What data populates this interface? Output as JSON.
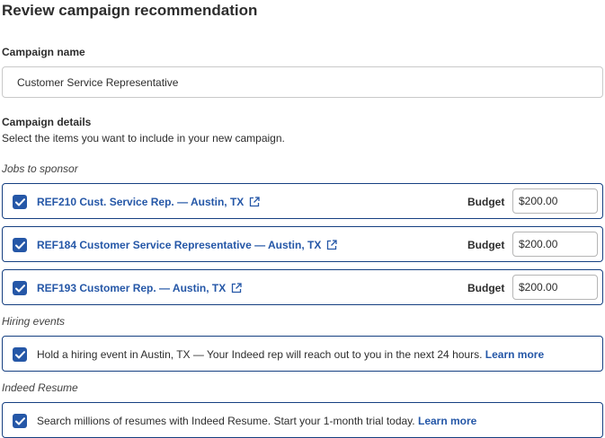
{
  "header": {
    "title": "Review campaign recommendation"
  },
  "campaign_name": {
    "label": "Campaign name",
    "value": "Customer Service Representative"
  },
  "campaign_details": {
    "label": "Campaign details",
    "instructions": "Select the items you want to include in your new campaign."
  },
  "jobs": {
    "group_label": "Jobs to sponsor",
    "budget_label": "Budget",
    "items": [
      {
        "title": "REF210 Cust. Service Rep. — Austin, TX",
        "checked": true,
        "budget": "$200.00"
      },
      {
        "title": "REF184 Customer Service Representative — Austin, TX",
        "checked": true,
        "budget": "$200.00"
      },
      {
        "title": "REF193 Customer Rep. — Austin, TX",
        "checked": true,
        "budget": "$200.00"
      }
    ]
  },
  "hiring_events": {
    "group_label": "Hiring events",
    "text": "Hold a hiring event in Austin, TX — Your Indeed rep will reach out to you in the next 24 hours.",
    "link": "Learn more",
    "checked": true
  },
  "indeed_resume": {
    "group_label": "Indeed Resume",
    "text": "Search millions of resumes with Indeed Resume. Start your 1-month trial today.",
    "link": "Learn more",
    "checked": true
  },
  "colors": {
    "accent": "#2557a7",
    "card_border": "#164081",
    "text": "#2d2d2d"
  },
  "icons": {
    "checkbox": "checkmark-icon",
    "external": "external-link-icon"
  }
}
